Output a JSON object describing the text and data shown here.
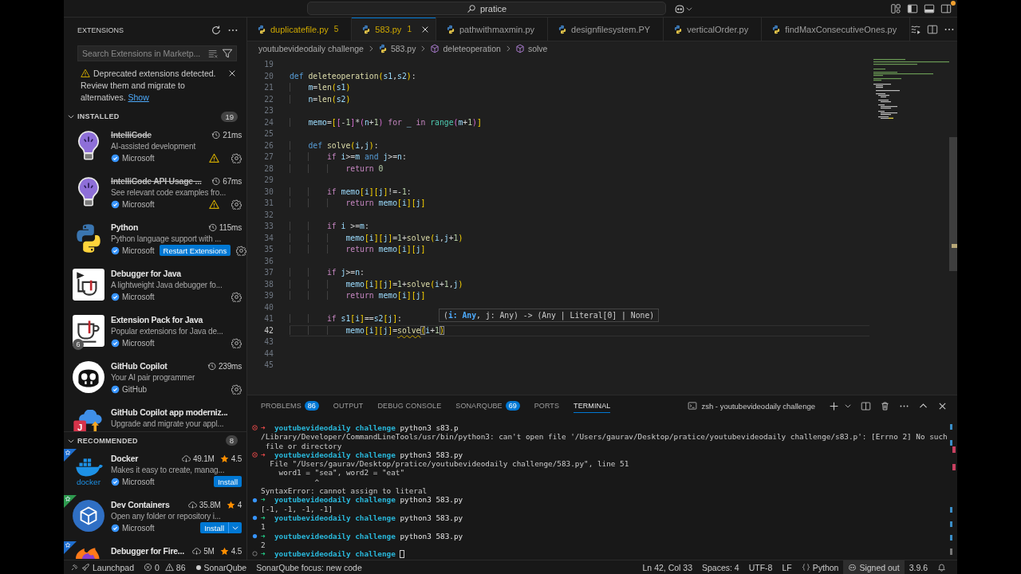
{
  "title_bar": {
    "search": "pratice"
  },
  "sidebar": {
    "title": "EXTENSIONS",
    "search": {
      "placeholder": "Search Extensions in Marketp..."
    },
    "notice": {
      "text": "Deprecated extensions detected. Review them and migrate to alternatives.",
      "link": "Show"
    },
    "sections": [
      {
        "title": "INSTALLED",
        "count": "19",
        "expanded": true,
        "items": [
          {
            "name": "IntelliCode",
            "deprecated": true,
            "description": "AI-assisted development",
            "publisher": "Microsoft",
            "activation_time": "21ms",
            "warning": true
          },
          {
            "name": "IntelliCode API Usage ...",
            "deprecated": true,
            "description": "See relevant code examples fro...",
            "publisher": "Microsoft",
            "activation_time": "67ms",
            "warning": true
          },
          {
            "name": "Python",
            "deprecated": false,
            "description": "Python language support with ...",
            "publisher": "Microsoft",
            "activation_time": "115ms",
            "warning": false,
            "action": {
              "label": "Restart Extensions",
              "dropdown": false
            }
          },
          {
            "name": "Debugger for Java",
            "deprecated": false,
            "description": "A lightweight Java debugger fo...",
            "publisher": "Microsoft",
            "warning": false
          },
          {
            "name": "Extension Pack for Java",
            "deprecated": false,
            "description": "Popular extensions for Java de...",
            "publisher": "Microsoft",
            "warning": false,
            "pack_count": "6"
          },
          {
            "name": "GitHub Copilot",
            "deprecated": false,
            "description": "Your AI pair programmer",
            "publisher": "GitHub",
            "activation_time": "239ms",
            "warning": false
          },
          {
            "name": "GitHub Copilot app moderniz...",
            "deprecated": false,
            "description": "Upgrade and migrate your appl...",
            "warning": false,
            "logo_text": "J"
          }
        ]
      },
      {
        "title": "RECOMMENDED",
        "count": "8",
        "expanded": true,
        "items": [
          {
            "name": "Docker",
            "deprecated": false,
            "description": "Makes it easy to create, manag...",
            "publisher": "Microsoft",
            "downloads": "49.1M",
            "rating": "4.5",
            "warning": false,
            "color": "#1f6fd0",
            "logo_text": "docker",
            "action": {
              "label": "Install",
              "dropdown": false
            }
          },
          {
            "name": "Dev Containers",
            "deprecated": false,
            "description": "Open any folder or repository i...",
            "publisher": "Microsoft",
            "downloads": "35.8M",
            "rating": "4",
            "warning": false,
            "color": "#2e9b4f",
            "action": {
              "label": "Install",
              "dropdown": true
            }
          },
          {
            "name": "Debugger for Fire...",
            "deprecated": false,
            "downloads": "5M",
            "rating": "4.5",
            "warning": false,
            "color": "#1f6fd0"
          }
        ]
      }
    ]
  },
  "editor": {
    "tabs": [
      {
        "label": "duplicatefile.py",
        "problems": "5",
        "selected": false
      },
      {
        "label": "583.py",
        "problems": "1",
        "selected": true
      },
      {
        "label": "pathwithmaxmin.py",
        "selected": false
      },
      {
        "label": "designfilesystem.PY",
        "selected": false
      },
      {
        "label": "verticalOrder.py",
        "selected": false
      },
      {
        "label": "findMaxConsecutiveOnes.py",
        "selected": false
      }
    ],
    "breadcrumbs": [
      {
        "label": "youtubevideodaily challenge",
        "kind": "folder"
      },
      {
        "label": "583.py",
        "kind": "file"
      },
      {
        "label": "deleteoperation",
        "kind": "symbol"
      },
      {
        "label": "solve",
        "kind": "symbol"
      }
    ],
    "lines": [
      {
        "number": "19",
        "current": false
      },
      {
        "number": "20",
        "current": false,
        "tokens": [
          {
            "kind": "storage",
            "text": "def "
          },
          {
            "kind": "function",
            "text": "deleteoperation"
          },
          {
            "kind": "bracket1",
            "text": "("
          },
          {
            "kind": "variable",
            "text": "s1"
          },
          {
            "kind": "plain",
            "text": ","
          },
          {
            "kind": "variable",
            "text": "s2"
          },
          {
            "kind": "bracket1",
            "text": ")"
          },
          {
            "kind": "plain",
            "text": ":"
          }
        ]
      },
      {
        "number": "21",
        "current": false,
        "tokens": [
          {
            "kind": "variable",
            "text": "    m"
          },
          {
            "kind": "plain",
            "text": "="
          },
          {
            "kind": "function",
            "text": "len"
          },
          {
            "kind": "bracket1",
            "text": "("
          },
          {
            "kind": "variable",
            "text": "s1"
          },
          {
            "kind": "bracket1",
            "text": ")"
          }
        ]
      },
      {
        "number": "22",
        "current": false,
        "tokens": [
          {
            "kind": "variable",
            "text": "    n"
          },
          {
            "kind": "plain",
            "text": "="
          },
          {
            "kind": "function",
            "text": "len"
          },
          {
            "kind": "bracket1",
            "text": "("
          },
          {
            "kind": "variable",
            "text": "s2"
          },
          {
            "kind": "bracket1",
            "text": ")"
          }
        ]
      },
      {
        "number": "23",
        "current": false
      },
      {
        "number": "24",
        "current": false,
        "tokens": [
          {
            "kind": "variable",
            "text": "    memo"
          },
          {
            "kind": "plain",
            "text": "="
          },
          {
            "kind": "bracket1",
            "text": "["
          },
          {
            "kind": "bracket2",
            "text": "["
          },
          {
            "kind": "plain",
            "text": "-"
          },
          {
            "kind": "number",
            "text": "1"
          },
          {
            "kind": "bracket2",
            "text": "]"
          },
          {
            "kind": "plain",
            "text": "*"
          },
          {
            "kind": "bracket2",
            "text": "("
          },
          {
            "kind": "variable",
            "text": "n"
          },
          {
            "kind": "plain",
            "text": "+"
          },
          {
            "kind": "number",
            "text": "1"
          },
          {
            "kind": "bracket2",
            "text": ")"
          },
          {
            "kind": "keyword",
            "text": " for "
          },
          {
            "kind": "variable",
            "text": "_"
          },
          {
            "kind": "keyword",
            "text": " in "
          },
          {
            "kind": "builtin",
            "text": "range"
          },
          {
            "kind": "bracket2",
            "text": "("
          },
          {
            "kind": "variable",
            "text": "m"
          },
          {
            "kind": "plain",
            "text": "+"
          },
          {
            "kind": "number",
            "text": "1"
          },
          {
            "kind": "bracket2",
            "text": ")"
          },
          {
            "kind": "bracket1",
            "text": "]"
          }
        ]
      },
      {
        "number": "25",
        "current": false
      },
      {
        "number": "26",
        "current": false,
        "tokens": [
          {
            "kind": "storage",
            "text": "    def "
          },
          {
            "kind": "function",
            "text": "solve"
          },
          {
            "kind": "bracket1",
            "text": "("
          },
          {
            "kind": "variable",
            "text": "i"
          },
          {
            "kind": "plain",
            "text": ","
          },
          {
            "kind": "variable",
            "text": "j"
          },
          {
            "kind": "bracket1",
            "text": ")"
          },
          {
            "kind": "plain",
            "text": ":"
          }
        ]
      },
      {
        "number": "27",
        "current": false,
        "tokens": [
          {
            "kind": "keyword",
            "text": "        if "
          },
          {
            "kind": "variable",
            "text": "i"
          },
          {
            "kind": "plain",
            "text": ">="
          },
          {
            "kind": "variable",
            "text": "m"
          },
          {
            "kind": "storage",
            "text": " and "
          },
          {
            "kind": "variable",
            "text": "j"
          },
          {
            "kind": "plain",
            "text": ">="
          },
          {
            "kind": "variable",
            "text": "n"
          },
          {
            "kind": "plain",
            "text": ":"
          }
        ]
      },
      {
        "number": "28",
        "current": false,
        "tokens": [
          {
            "kind": "keyword",
            "text": "            return "
          },
          {
            "kind": "number",
            "text": "0"
          }
        ]
      },
      {
        "number": "29",
        "current": false
      },
      {
        "number": "30",
        "current": false,
        "tokens": [
          {
            "kind": "keyword",
            "text": "        if "
          },
          {
            "kind": "variable",
            "text": "memo"
          },
          {
            "kind": "bracket1",
            "text": "["
          },
          {
            "kind": "variable",
            "text": "i"
          },
          {
            "kind": "bracket1",
            "text": "]["
          },
          {
            "kind": "variable",
            "text": "j"
          },
          {
            "kind": "bracket1",
            "text": "]"
          },
          {
            "kind": "plain",
            "text": "!=-"
          },
          {
            "kind": "number",
            "text": "1"
          },
          {
            "kind": "plain",
            "text": ":"
          }
        ]
      },
      {
        "number": "31",
        "current": false,
        "tokens": [
          {
            "kind": "keyword",
            "text": "            return "
          },
          {
            "kind": "variable",
            "text": "memo"
          },
          {
            "kind": "bracket1",
            "text": "["
          },
          {
            "kind": "variable",
            "text": "i"
          },
          {
            "kind": "bracket1",
            "text": "]["
          },
          {
            "kind": "variable",
            "text": "j"
          },
          {
            "kind": "bracket1",
            "text": "]"
          }
        ]
      },
      {
        "number": "32",
        "current": false
      },
      {
        "number": "33",
        "current": false,
        "tokens": [
          {
            "kind": "keyword",
            "text": "        if "
          },
          {
            "kind": "variable",
            "text": "i"
          },
          {
            "kind": "plain",
            "text": " >="
          },
          {
            "kind": "variable",
            "text": "m"
          },
          {
            "kind": "plain",
            "text": ":"
          }
        ]
      },
      {
        "number": "34",
        "current": false,
        "tokens": [
          {
            "kind": "variable",
            "text": "            memo"
          },
          {
            "kind": "bracket1",
            "text": "["
          },
          {
            "kind": "variable",
            "text": "i"
          },
          {
            "kind": "bracket1",
            "text": "]["
          },
          {
            "kind": "variable",
            "text": "j"
          },
          {
            "kind": "bracket1",
            "text": "]"
          },
          {
            "kind": "plain",
            "text": "="
          },
          {
            "kind": "number",
            "text": "1"
          },
          {
            "kind": "plain",
            "text": "+"
          },
          {
            "kind": "function",
            "text": "solve"
          },
          {
            "kind": "bracket1",
            "text": "("
          },
          {
            "kind": "variable",
            "text": "i"
          },
          {
            "kind": "plain",
            "text": ","
          },
          {
            "kind": "variable",
            "text": "j"
          },
          {
            "kind": "plain",
            "text": "+"
          },
          {
            "kind": "number",
            "text": "1"
          },
          {
            "kind": "bracket1",
            "text": ")"
          }
        ]
      },
      {
        "number": "35",
        "current": false,
        "tokens": [
          {
            "kind": "keyword",
            "text": "            return "
          },
          {
            "kind": "variable",
            "text": "memo"
          },
          {
            "kind": "bracket1",
            "text": "["
          },
          {
            "kind": "variable",
            "text": "i"
          },
          {
            "kind": "bracket1",
            "text": "]["
          },
          {
            "kind": "variable",
            "text": "j"
          },
          {
            "kind": "bracket1",
            "text": "]"
          }
        ]
      },
      {
        "number": "36",
        "current": false
      },
      {
        "number": "37",
        "current": false,
        "tokens": [
          {
            "kind": "keyword",
            "text": "        if "
          },
          {
            "kind": "variable",
            "text": "j"
          },
          {
            "kind": "plain",
            "text": ">="
          },
          {
            "kind": "variable",
            "text": "n"
          },
          {
            "kind": "plain",
            "text": ":"
          }
        ]
      },
      {
        "number": "38",
        "current": false,
        "tokens": [
          {
            "kind": "variable",
            "text": "            memo"
          },
          {
            "kind": "bracket1",
            "text": "["
          },
          {
            "kind": "variable",
            "text": "i"
          },
          {
            "kind": "bracket1",
            "text": "]["
          },
          {
            "kind": "variable",
            "text": "j"
          },
          {
            "kind": "bracket1",
            "text": "]"
          },
          {
            "kind": "plain",
            "text": "="
          },
          {
            "kind": "number",
            "text": "1"
          },
          {
            "kind": "plain",
            "text": "+"
          },
          {
            "kind": "function",
            "text": "solve"
          },
          {
            "kind": "bracket1",
            "text": "("
          },
          {
            "kind": "variable",
            "text": "i"
          },
          {
            "kind": "plain",
            "text": "+"
          },
          {
            "kind": "number",
            "text": "1"
          },
          {
            "kind": "plain",
            "text": ","
          },
          {
            "kind": "variable",
            "text": "j"
          },
          {
            "kind": "bracket1",
            "text": ")"
          }
        ]
      },
      {
        "number": "39",
        "current": false,
        "tokens": [
          {
            "kind": "keyword",
            "text": "            return "
          },
          {
            "kind": "variable",
            "text": "memo"
          },
          {
            "kind": "bracket1",
            "text": "["
          },
          {
            "kind": "variable",
            "text": "i"
          },
          {
            "kind": "bracket1",
            "text": "]["
          },
          {
            "kind": "variable",
            "text": "j"
          },
          {
            "kind": "bracket1",
            "text": "]"
          }
        ]
      },
      {
        "number": "40",
        "current": false
      },
      {
        "number": "41",
        "current": false,
        "tokens": [
          {
            "kind": "keyword",
            "text": "        if "
          },
          {
            "kind": "variable",
            "text": "s1"
          },
          {
            "kind": "bracket1",
            "text": "["
          },
          {
            "kind": "variable",
            "text": "i"
          },
          {
            "kind": "bracket1",
            "text": "]"
          },
          {
            "kind": "plain",
            "text": "=="
          },
          {
            "kind": "variable",
            "text": "s2"
          },
          {
            "kind": "bracket1",
            "text": "["
          },
          {
            "kind": "variable",
            "text": "j"
          },
          {
            "kind": "bracket1",
            "text": "]"
          },
          {
            "kind": "plain",
            "text": ":"
          }
        ]
      },
      {
        "number": "42",
        "current": true,
        "tokens": [
          {
            "kind": "variable",
            "text": "            memo"
          },
          {
            "kind": "bracket1",
            "text": "["
          },
          {
            "kind": "variable",
            "text": "i"
          },
          {
            "kind": "bracket1",
            "text": "]["
          },
          {
            "kind": "variable",
            "text": "j"
          },
          {
            "kind": "bracket1",
            "text": "]"
          },
          {
            "kind": "plain",
            "text": "="
          },
          {
            "kind": "function_warning",
            "text": "solve"
          },
          {
            "kind": "bracket_match",
            "text": "("
          },
          {
            "kind": "variable",
            "text": "i"
          },
          {
            "kind": "plain",
            "text": "+"
          },
          {
            "kind": "number",
            "text": "1"
          },
          {
            "kind": "bracket_match",
            "text": ")"
          }
        ]
      },
      {
        "number": "43",
        "current": false
      },
      {
        "number": "44",
        "current": false
      },
      {
        "number": "45",
        "current": false
      }
    ],
    "signature_help": "(**i: Any**, j: Any) -> (Any | Literal[0] | None)"
  },
  "panel": {
    "tabs": [
      {
        "label": "PROBLEMS",
        "count": "86",
        "selected": false
      },
      {
        "label": "OUTPUT",
        "selected": false
      },
      {
        "label": "DEBUG CONSOLE",
        "selected": false
      },
      {
        "label": "SONARQUBE",
        "count": "69",
        "selected": false
      },
      {
        "label": "PORTS",
        "selected": false
      },
      {
        "label": "TERMINAL",
        "selected": true
      }
    ],
    "terminal_title": "zsh - youtubevideodaily challenge",
    "terminal": [
      {
        "kind": "prompt",
        "completed": true,
        "error": true,
        "arrow": "➜",
        "directory": "youtubevideodaily challenge",
        "command": "python3 s83.p",
        "cursor": false
      },
      {
        "kind": "output",
        "text": "/Library/Developer/CommandLineTools/usr/bin/python3: can't open file '/Users/gaurav/Desktop/pratice/youtubevideodaily challenge/s83.p': [Errno 2] No such"
      },
      {
        "kind": "output",
        "text": " file or directory"
      },
      {
        "kind": "prompt",
        "completed": true,
        "error": true,
        "arrow": "➜",
        "directory": "youtubevideodaily challenge",
        "command": "python3 583.py",
        "cursor": false
      },
      {
        "kind": "output",
        "text": "  File \"/Users/gaurav/Desktop/pratice/youtubevideodaily challenge/583.py\", line 51"
      },
      {
        "kind": "output",
        "text": "    word1 = \"sea\", word2 = \"eat\""
      },
      {
        "kind": "output",
        "text": "            ^"
      },
      {
        "kind": "output",
        "text": "SyntaxError: cannot assign to literal"
      },
      {
        "kind": "prompt",
        "completed": true,
        "error": false,
        "arrow": "➜",
        "directory": "youtubevideodaily challenge",
        "command": "python3 583.py",
        "cursor": false
      },
      {
        "kind": "output",
        "text": "[-1, -1, -1, -1]"
      },
      {
        "kind": "prompt",
        "completed": true,
        "error": false,
        "arrow": "➜",
        "directory": "youtubevideodaily challenge",
        "command": "python3 583.py",
        "cursor": false
      },
      {
        "kind": "output",
        "text": "1"
      },
      {
        "kind": "prompt",
        "completed": true,
        "error": false,
        "arrow": "➜",
        "directory": "youtubevideodaily challenge",
        "command": "python3 583.py",
        "cursor": false
      },
      {
        "kind": "output",
        "text": "2"
      },
      {
        "kind": "prompt",
        "completed": false,
        "error": false,
        "arrow": "➜",
        "directory": "youtubevideodaily challenge",
        "cursor": true
      }
    ]
  },
  "status_bar": {
    "left": [
      {
        "kind": "launchpad",
        "label": "Launchpad"
      },
      {
        "kind": "problems",
        "errors": "0",
        "warnings": "86"
      },
      {
        "kind": "sonar",
        "label": "SonarQube"
      },
      {
        "kind": "text",
        "label": "SonarQube focus: new code"
      }
    ],
    "right": [
      {
        "kind": "text",
        "label": "Ln 42, Col 33"
      },
      {
        "kind": "text",
        "label": "Spaces: 4"
      },
      {
        "kind": "text",
        "label": "UTF-8"
      },
      {
        "kind": "text",
        "label": "LF"
      },
      {
        "kind": "language",
        "label": "Python"
      },
      {
        "kind": "account",
        "label": "Signed out"
      },
      {
        "kind": "text",
        "label": "3.9.6"
      },
      {
        "kind": "bell"
      }
    ]
  }
}
